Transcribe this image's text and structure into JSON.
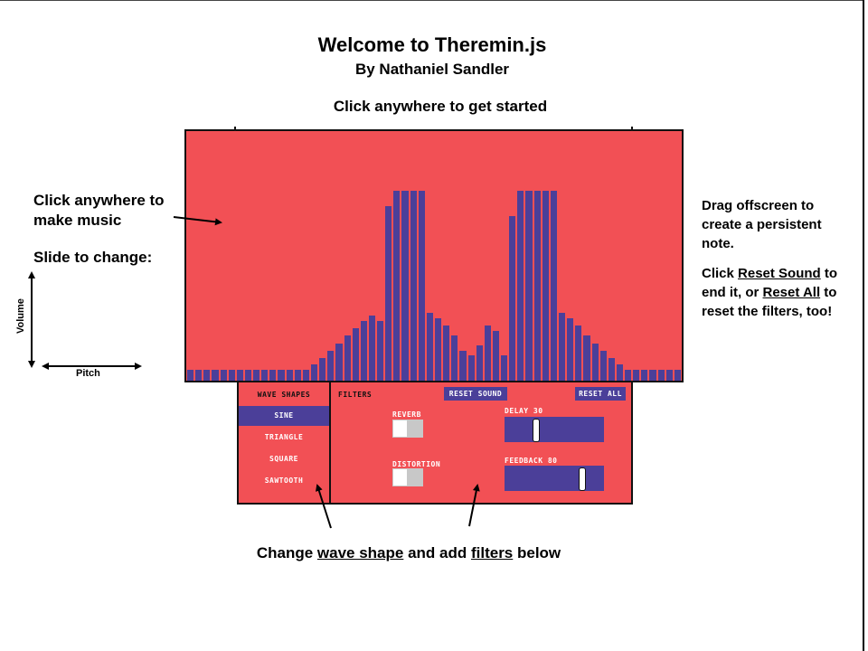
{
  "header": {
    "title": "Welcome to Theremin.js",
    "author": "By Nathaniel Sandler",
    "prompt": "Click anywhere to get started"
  },
  "annotations": {
    "click_music": [
      "Click anywhere to",
      "make music"
    ],
    "slide_change": "Slide to change:",
    "volume": "Volume",
    "pitch": "Pitch",
    "drag_offscreen": [
      "Drag offscreen to",
      "create a persistent",
      "note."
    ],
    "reset_click": "Click ",
    "reset_sound_link": "Reset Sound",
    "reset_to": " to",
    "reset_end": "end it, or ",
    "reset_all_link": "Reset All",
    "reset_to2": " to",
    "reset_filters": "reset the filters, too!",
    "bottom_pre": "Change ",
    "bottom_wave": "wave shape",
    "bottom_mid": " and add ",
    "bottom_filters": "filters",
    "bottom_post": " below"
  },
  "visualizer": {
    "bar_color": "#4b3f99",
    "background": "#f25055",
    "levels": [
      0.045,
      0.045,
      0.045,
      0.045,
      0.045,
      0.045,
      0.045,
      0.045,
      0.045,
      0.045,
      0.045,
      0.045,
      0.045,
      0.045,
      0.045,
      0.065,
      0.09,
      0.12,
      0.15,
      0.18,
      0.21,
      0.24,
      0.26,
      0.24,
      0.7,
      0.76,
      0.76,
      0.76,
      0.76,
      0.27,
      0.25,
      0.22,
      0.18,
      0.12,
      0.1,
      0.14,
      0.22,
      0.2,
      0.1,
      0.66,
      0.76,
      0.76,
      0.76,
      0.76,
      0.76,
      0.27,
      0.25,
      0.22,
      0.18,
      0.15,
      0.12,
      0.09,
      0.065,
      0.045,
      0.045,
      0.045,
      0.045,
      0.045,
      0.045,
      0.045
    ]
  },
  "wave_shapes": {
    "heading": "WAVE SHAPES",
    "items": [
      "SINE",
      "TRIANGLE",
      "SQUARE",
      "SAWTOOTH"
    ],
    "selected": "SINE"
  },
  "filters": {
    "heading": "FILTERS",
    "reset_sound": "RESET SOUND",
    "reset_all": "RESET ALL",
    "reverb_label": "REVERB",
    "reverb_on": false,
    "distortion_label": "DISTORTION",
    "distortion_on": false,
    "delay_label": "DELAY 30",
    "delay_value": 30,
    "feedback_label": "FEEDBACK 80",
    "feedback_value": 80
  }
}
